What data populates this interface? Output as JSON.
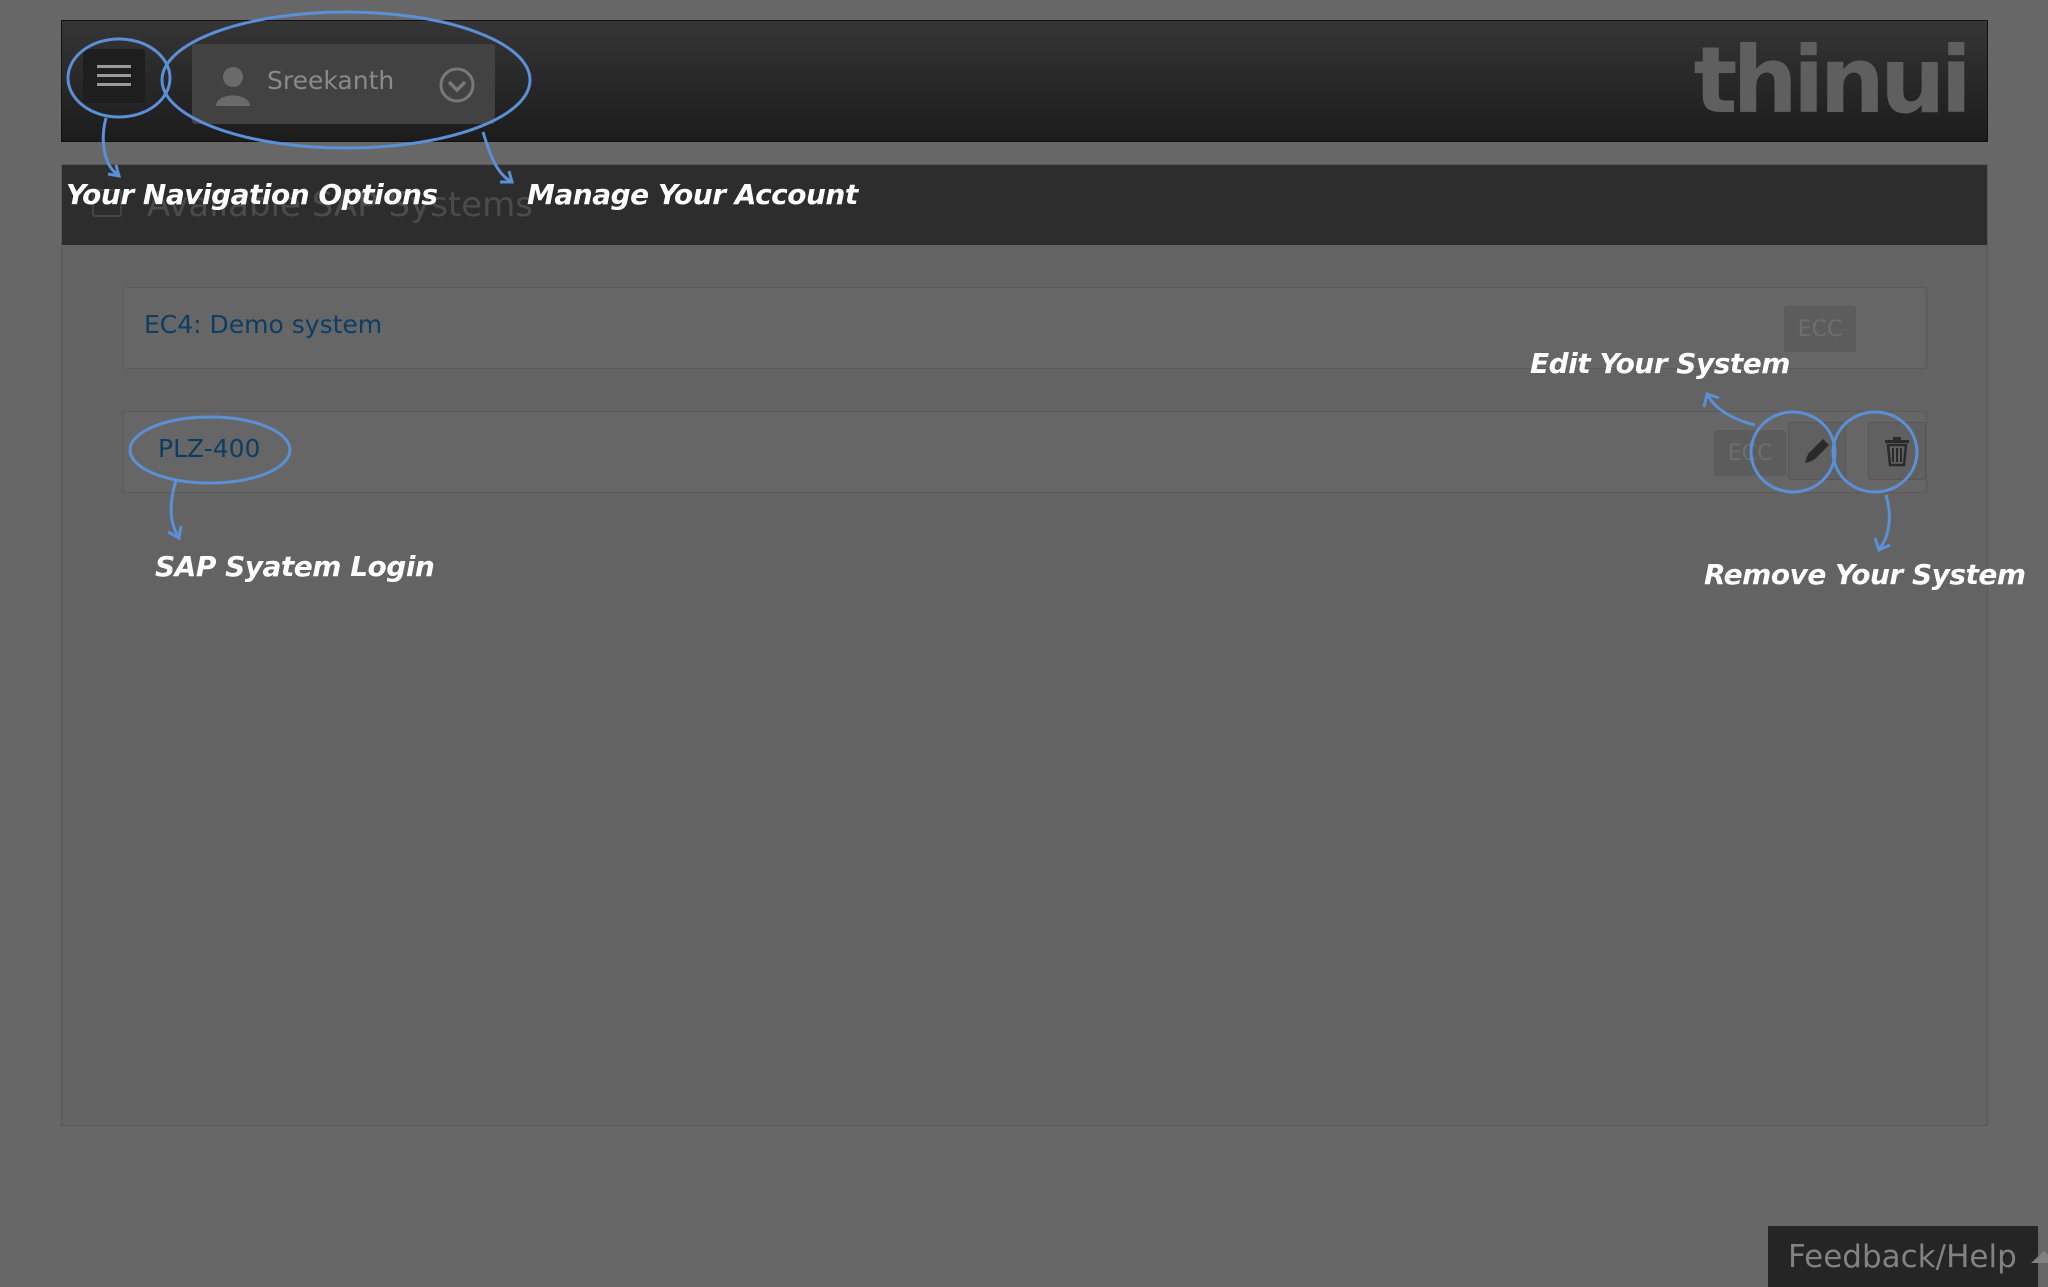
{
  "header": {
    "menu_icon": "hamburger-icon",
    "user_name": "Sreekanth",
    "user_icon": "person-icon",
    "dropdown_icon": "chevron-down-circle-icon",
    "logo_text": "thinui"
  },
  "panel": {
    "title": "Available SAP Systems"
  },
  "systems": [
    {
      "label": "EC4: Demo system",
      "badge": "ECC"
    },
    {
      "label": "PLZ-400",
      "badge": "ECC",
      "edit_icon": "pencil-icon",
      "delete_icon": "trash-icon"
    }
  ],
  "annotations": {
    "navigation": "Your Navigation Options",
    "account": "Manage Your Account",
    "edit": "Edit Your System",
    "login": "SAP Syatem Login",
    "remove": "Remove Your System",
    "accent_color": "#5b8fd6"
  },
  "feedback": {
    "label": "Feedback/Help"
  }
}
